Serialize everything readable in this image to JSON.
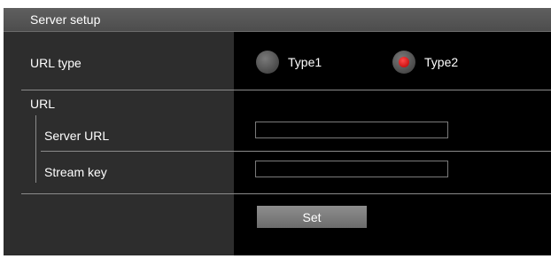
{
  "section": {
    "title": "Server setup"
  },
  "url_type": {
    "label": "URL type",
    "options": [
      {
        "label": "Type1",
        "selected": false
      },
      {
        "label": "Type2",
        "selected": true
      }
    ]
  },
  "url": {
    "label": "URL",
    "server_url": {
      "label": "Server URL",
      "value": ""
    },
    "stream_key": {
      "label": "Stream key",
      "value": ""
    }
  },
  "actions": {
    "set_label": "Set"
  },
  "colors": {
    "panel": "#2d2d2d",
    "field_bg": "#000000",
    "header": "#555555",
    "radio_selected": "#e02020"
  }
}
